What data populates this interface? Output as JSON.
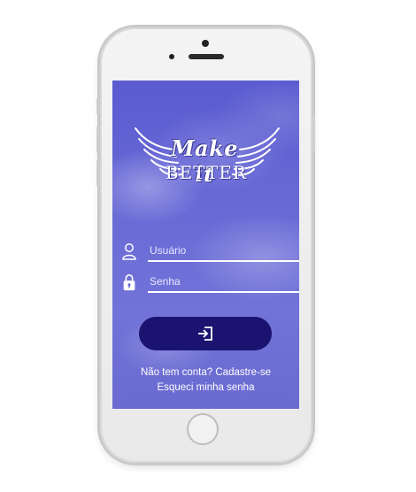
{
  "logo": {
    "line1": "Make it",
    "line2": "BETTER"
  },
  "form": {
    "username_placeholder": "Usuário",
    "password_placeholder": "Senha",
    "login_icon": "login-arrow-icon"
  },
  "footer": {
    "no_account_text": "Não tem conta?",
    "signup_link": "Cadastre-se",
    "forgot_link": "Esqueci minha senha"
  },
  "colors": {
    "background_top": "#5a5bd0",
    "background_bottom": "#6a6ad0",
    "button": "#1a1470",
    "text": "#ffffff"
  },
  "icons": [
    "user-icon",
    "lock-icon",
    "login-arrow-icon",
    "wings-logo-icon"
  ]
}
